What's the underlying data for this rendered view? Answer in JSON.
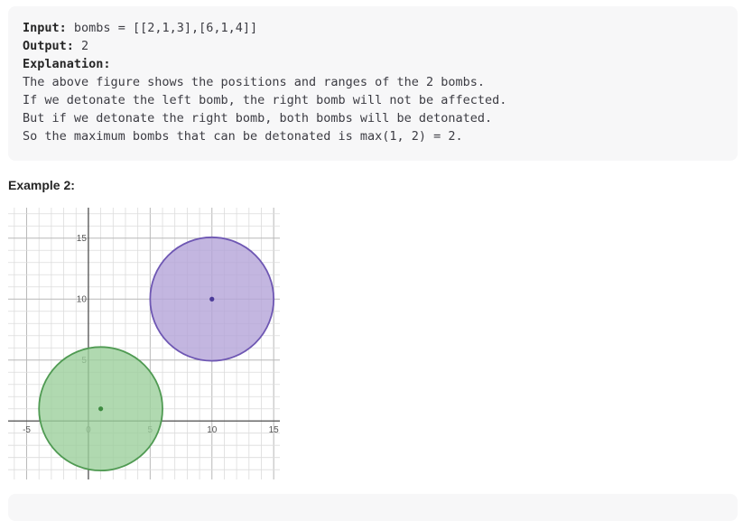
{
  "example1": {
    "input_label": "Input:",
    "input_value": "bombs = [[2,1,3],[6,1,4]]",
    "output_label": "Output:",
    "output_value": "2",
    "explanation_label": "Explanation:",
    "explanation_lines": [
      "The above figure shows the positions and ranges of the 2 bombs.",
      "If we detonate the left bomb, the right bomb will not be affected.",
      "But if we detonate the right bomb, both bombs will be detonated.",
      "So the maximum bombs that can be detonated is max(1, 2) = 2."
    ]
  },
  "example2": {
    "heading": "Example 2:"
  },
  "chart_data": {
    "type": "scatter",
    "title": "",
    "xlabel": "",
    "ylabel": "",
    "xlim": [
      -6.5,
      15.5
    ],
    "ylim": [
      -4.8,
      17.5
    ],
    "grid": true,
    "x_ticks": [
      -5,
      0,
      5,
      10,
      15
    ],
    "y_ticks": [
      5,
      10,
      15
    ],
    "x_tick_labels": [
      "-5",
      "0",
      "5",
      "10",
      "15"
    ],
    "y_tick_labels": [
      "5",
      "10",
      "15"
    ],
    "circles": [
      {
        "x": 1,
        "y": 1,
        "r": 5,
        "fill": "#9ccf9c",
        "stroke": "#4f9a52",
        "dot": "#3d8b40"
      },
      {
        "x": 10,
        "y": 10,
        "r": 5,
        "fill": "#b4a4d8",
        "stroke": "#6e57b3",
        "dot": "#4b3a99"
      }
    ]
  }
}
